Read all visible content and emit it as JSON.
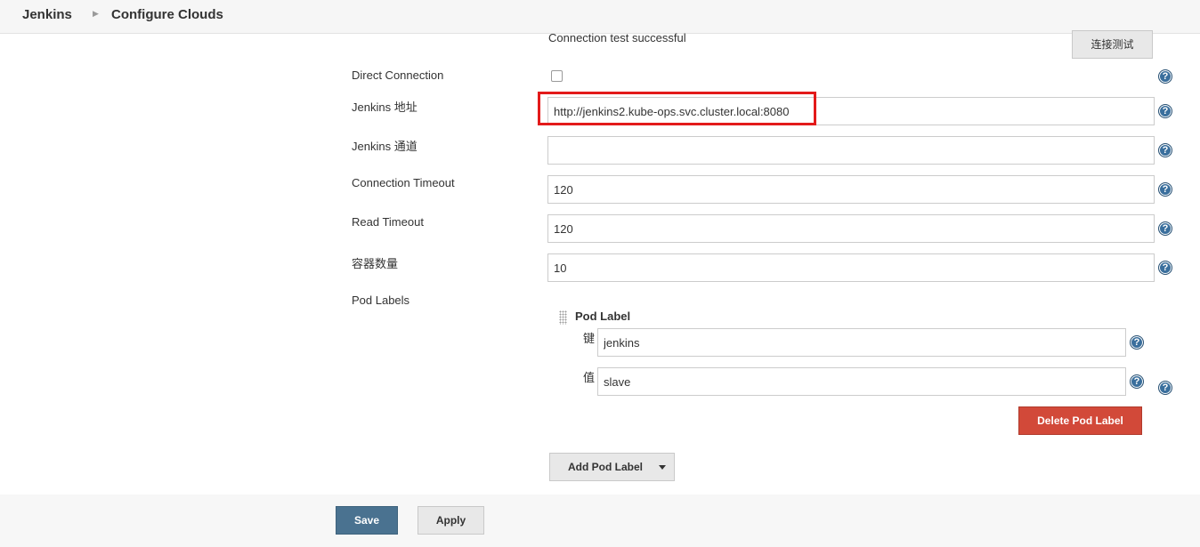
{
  "breadcrumb": {
    "root": "Jenkins",
    "current": "Configure Clouds"
  },
  "connection_test": {
    "status": "Connection test successful",
    "button_label": "连接测试"
  },
  "fields": {
    "direct_connection": {
      "label": "Direct Connection",
      "checked": false
    },
    "jenkins_url": {
      "label": "Jenkins 地址",
      "value": "http://jenkins2.kube-ops.svc.cluster.local:8080"
    },
    "jenkins_tunnel": {
      "label": "Jenkins 通道",
      "value": ""
    },
    "connection_timeout": {
      "label": "Connection Timeout",
      "value": "120"
    },
    "read_timeout": {
      "label": "Read Timeout",
      "value": "120"
    },
    "container_cap": {
      "label": "容器数量",
      "value": "10"
    }
  },
  "pod_labels": {
    "label": "Pod Labels",
    "item_title": "Pod Label",
    "key_label": "键",
    "key_value": "jenkins",
    "value_label": "值",
    "value_value": "slave",
    "delete_label": "Delete Pod Label",
    "add_label": "Add Pod Label"
  },
  "help_glyph": "?",
  "icons": {
    "help": "help-circle-icon",
    "drag": "drag-handle-icon",
    "dropdown": "chevron-down-icon"
  },
  "actions": {
    "save_label": "Save",
    "apply_label": "Apply"
  },
  "colors": {
    "save": "#4a7290",
    "delete": "#d24939",
    "highlight": "#e31a1a",
    "help": "#3a6f9d"
  }
}
